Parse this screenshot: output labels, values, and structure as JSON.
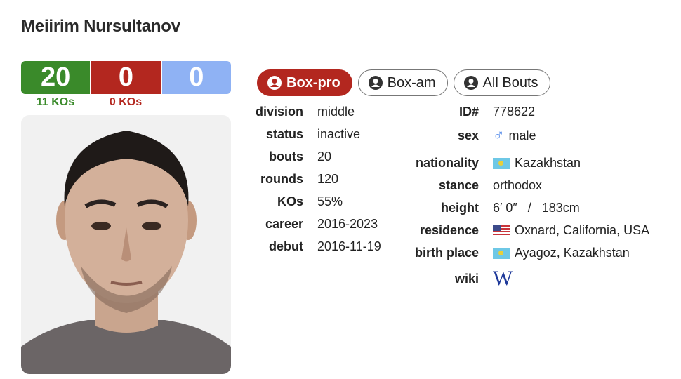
{
  "boxer": {
    "name": "Meiirim Nursultanov"
  },
  "record": {
    "wins": "20",
    "losses": "0",
    "draws": "0",
    "win_kos": "11 KOs",
    "loss_kos": "0 KOs"
  },
  "tabs": [
    {
      "label": "Box-pro",
      "active": true
    },
    {
      "label": "Box-am",
      "active": false
    },
    {
      "label": "All Bouts",
      "active": false
    }
  ],
  "left_info": [
    {
      "label": "division",
      "value": "middle"
    },
    {
      "label": "status",
      "value": "inactive"
    },
    {
      "label": "bouts",
      "value": "20"
    },
    {
      "label": "rounds",
      "value": "120"
    },
    {
      "label": "KOs",
      "value": "55%"
    },
    {
      "label": "career",
      "value": "2016-2023"
    },
    {
      "label": "debut",
      "value": "2016-11-19"
    }
  ],
  "right_info": {
    "id": {
      "label": "ID#",
      "value": "778622"
    },
    "sex": {
      "label": "sex",
      "value": "male",
      "icon": "male-symbol"
    },
    "nationality": {
      "label": "nationality",
      "value": "Kazakhstan",
      "flag": "kazakhstan-flag"
    },
    "stance": {
      "label": "stance",
      "value": "orthodox"
    },
    "height": {
      "label": "height",
      "value": "6′ 0″   /   183cm"
    },
    "residence": {
      "label": "residence",
      "value": "Oxnard, California, USA",
      "flag": "usa-flag"
    },
    "birth_place": {
      "label": "birth place",
      "value": "Ayagoz, Kazakhstan",
      "flag": "kazakhstan-flag"
    },
    "wiki": {
      "label": "wiki",
      "value": "W",
      "icon": "wikipedia-icon"
    }
  },
  "colors": {
    "win": "#3a8a2a",
    "loss": "#b3271f",
    "draw": "#8fb2f4",
    "male": "#4a84e8"
  }
}
